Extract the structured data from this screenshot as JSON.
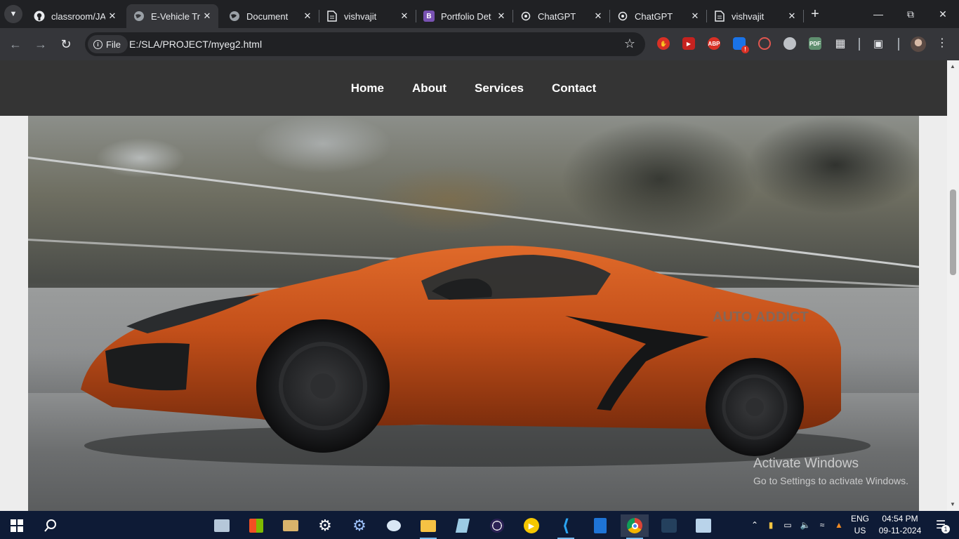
{
  "browser": {
    "tabs": [
      {
        "title": "classroom/JA",
        "favicon": "github-icon",
        "active": false
      },
      {
        "title": "E-Vehicle Tra",
        "favicon": "globe-icon",
        "active": true
      },
      {
        "title": "Document",
        "favicon": "globe-icon",
        "active": false
      },
      {
        "title": "vishvajit",
        "favicon": "file-icon",
        "active": false
      },
      {
        "title": "Portfolio Det",
        "favicon": "bootstrap-icon",
        "active": false
      },
      {
        "title": "ChatGPT",
        "favicon": "openai-icon",
        "active": false
      },
      {
        "title": "ChatGPT",
        "favicon": "openai-icon",
        "active": false
      },
      {
        "title": "vishvajit",
        "favicon": "file-icon",
        "active": false
      }
    ],
    "omnibox": {
      "chip_label": "File",
      "url": "E:/SLA/PROJECT/myeg2.html"
    },
    "extensions": [
      "stop-ext-icon",
      "video-ext-icon",
      "abp-icon",
      "puzzle-alert-icon",
      "swirl-ext-icon",
      "cookie-ext-icon",
      "pdf-ext-icon",
      "extensions-puzzle-icon"
    ],
    "abp_label": "ABP",
    "pdf_label": "PDF"
  },
  "site": {
    "nav": [
      "Home",
      "About",
      "Services",
      "Contact"
    ],
    "hero_badge": "AUTO ADDICT"
  },
  "watermark": {
    "line1": "Activate Windows",
    "line2": "Go to Settings to activate Windows."
  },
  "taskbar": {
    "language": "ENG",
    "region": "US",
    "time": "04:54 PM",
    "date": "09-11-2024",
    "notification_count": "1"
  },
  "colors": {
    "tab_bg": "#202124",
    "toolbar_bg": "#35363a",
    "site_nav_bg": "#343434",
    "car_orange": "#c4501a",
    "taskbar_bg": "#0e1b36"
  }
}
